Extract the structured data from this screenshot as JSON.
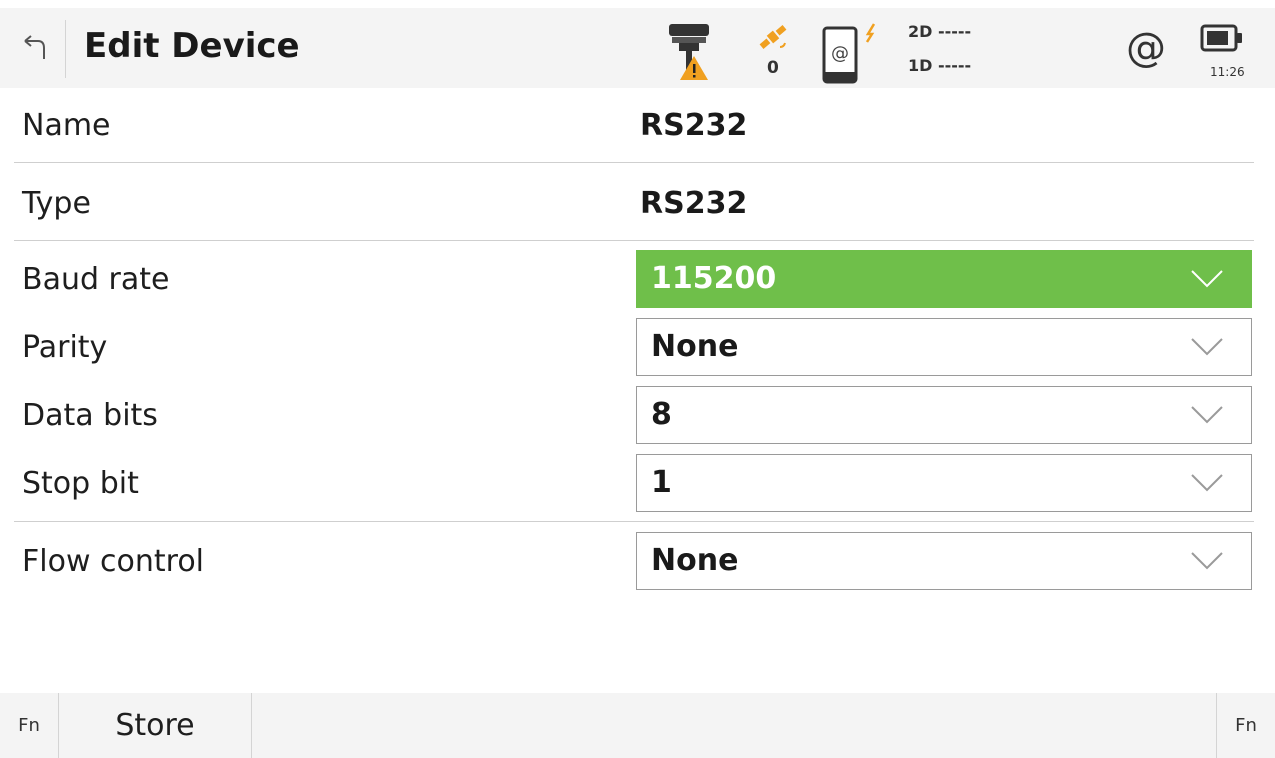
{
  "header": {
    "title": "Edit Device",
    "back_icon": "back-arrow-icon",
    "status": {
      "receiver_icon": "gnss-receiver-warning-icon",
      "satellite_icon": "satellite-icon",
      "satellite_count": "0",
      "device_link_icon": "device-link-icon",
      "quality_2d": "2D -----",
      "quality_1d": "1D -----",
      "internet_label": "@",
      "battery_icon": "battery-icon",
      "time": "11:26"
    }
  },
  "form": {
    "name": {
      "label": "Name",
      "value": "RS232"
    },
    "type": {
      "label": "Type",
      "value": "RS232"
    },
    "baud_rate": {
      "label": "Baud rate",
      "value": "115200"
    },
    "parity": {
      "label": "Parity",
      "value": "None"
    },
    "data_bits": {
      "label": "Data bits",
      "value": "8"
    },
    "stop_bit": {
      "label": "Stop bit",
      "value": "1"
    },
    "flow_control": {
      "label": "Flow control",
      "value": "None"
    }
  },
  "softkeys": {
    "fn_left": "Fn",
    "store": "Store",
    "fn_right": "Fn"
  },
  "colors": {
    "accent_green": "#6fbf4a",
    "warning_orange": "#f0a020",
    "bar_background": "#f4f4f4"
  }
}
